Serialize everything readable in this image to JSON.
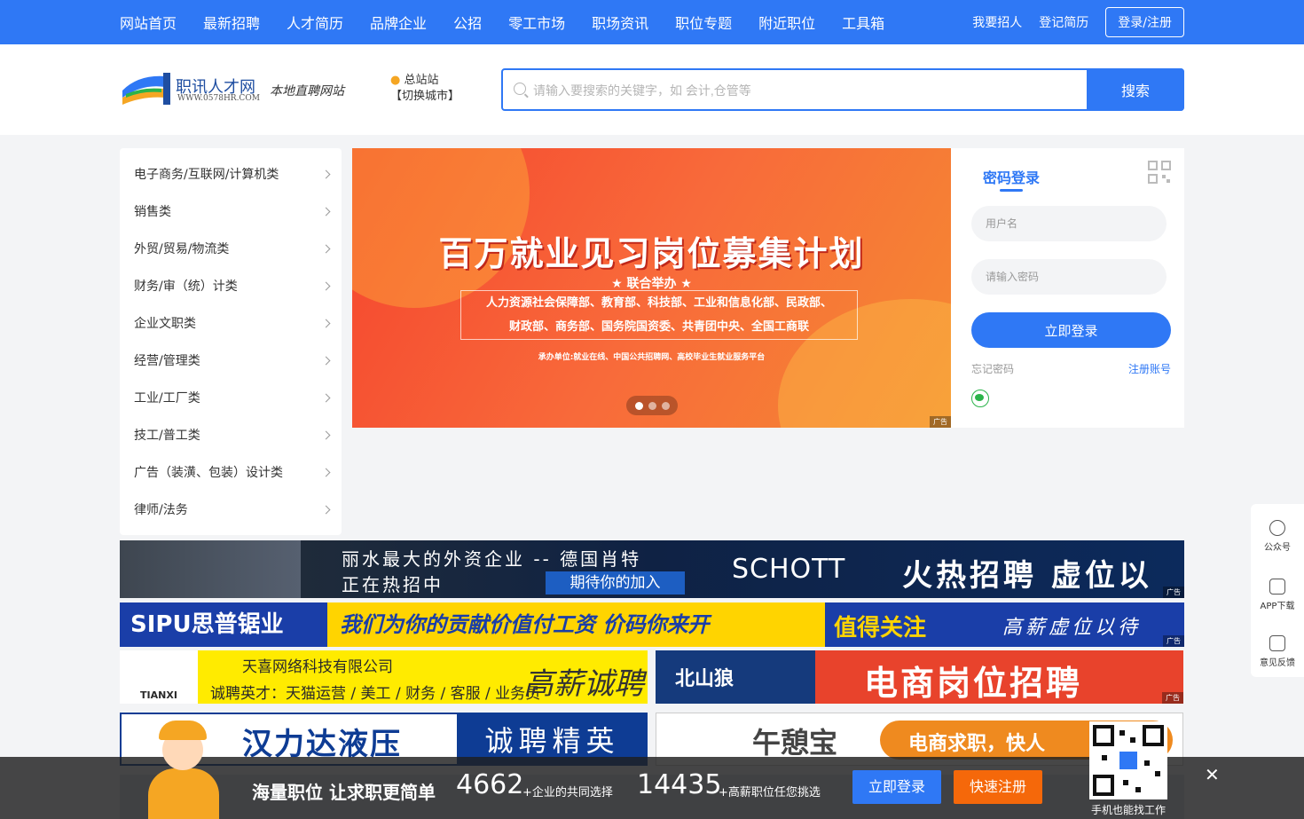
{
  "nav": {
    "items": [
      "网站首页",
      "最新招聘",
      "人才简历",
      "品牌企业",
      "公招",
      "零工市场",
      "职场资讯",
      "职位专题",
      "附近职位",
      "工具箱"
    ],
    "right": [
      "我要招人",
      "登记简历"
    ],
    "login": "登录/注册"
  },
  "header": {
    "logo_name": "职讯人才网",
    "logo_url": "WWW.0578HR.COM",
    "slogan": "本地直聘网站",
    "city": "总站站",
    "city_switch": "【切换城市】",
    "search_placeholder": "请输入要搜索的关键字，如 会计,仓管等",
    "search_button": "搜索"
  },
  "categories": [
    "电子商务/互联网/计算机类",
    "销售类",
    "外贸/贸易/物流类",
    "财务/审（统）计类",
    "企业文职类",
    "经营/管理类",
    "工业/工厂类",
    "技工/普工类",
    "广告（装潢、包装）设计类",
    "律师/法务"
  ],
  "banner": {
    "title": "百万就业见习岗位募集计划",
    "sub": "★ 联合举办 ★",
    "line1": "人力资源社会保障部、教育部、科技部、工业和信息化部、民政部、",
    "line2": "财政部、商务部、国务院国资委、共青团中央、全国工商联",
    "org": "承办单位:就业在线、中国公共招聘网、高校毕业生就业服务平台",
    "ad_tag": "广告"
  },
  "login": {
    "tab": "密码登录",
    "username_placeholder": "用户名",
    "password_placeholder": "请输入密码",
    "submit": "立即登录",
    "forgot": "忘记密码",
    "register": "注册账号"
  },
  "ads": {
    "schott_l1": "丽水最大的外资企业  --  德国肖特",
    "schott_l2": "正在热招中",
    "schott_pill": "期待你的加入",
    "schott_brand": "SCHOTT",
    "schott_slogan": "火热招聘  虚位以待",
    "sipu_brand": "SIPU思普锯业",
    "sipu_text": "我们为你的贡献价值付工资 价码你来开",
    "sipu_attention": "值得关注",
    "sipu_pay": "高薪虚位以待",
    "tianxi_logo": "TIANXI",
    "tianxi_name": "天喜网络科技有限公司",
    "tianxi_jobs": "诚聘英才：天猫运营 / 美工 / 财务 / 客服 / 业务员",
    "tianxi_slogan": "高薪诚聘",
    "bswolf_logo": "北山狼",
    "bswolf_text": "电商岗位招聘",
    "hanlida_name": "汉力达液压",
    "hanlida_slogan": "诚聘精英",
    "wudibao_name": "午憩宝",
    "wudibao_text": "电商求职，快人"
  },
  "bottombar": {
    "slogan": "海量职位 让求职更简单",
    "companies": "4662",
    "companies_desc": "+企业的共同选择",
    "jobs": "14435",
    "jobs_desc": "+高薪职位任您挑选",
    "login": "立即登录",
    "register": "快速注册",
    "qr_text": "手机也能找工作"
  },
  "sidetools": [
    "公众号",
    "APP下载",
    "意见反馈"
  ]
}
